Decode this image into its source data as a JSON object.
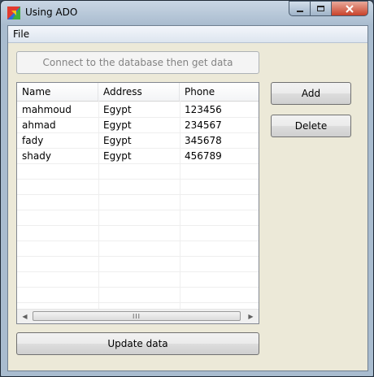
{
  "window": {
    "title": "Using ADO"
  },
  "menu": {
    "file": "File"
  },
  "buttons": {
    "connect": "Connect to the database then get data",
    "add": "Add",
    "delete": "Delete",
    "update": "Update data"
  },
  "table": {
    "columns": [
      "Name",
      "Address",
      "Phone"
    ],
    "rows": [
      [
        "mahmoud",
        "Egypt",
        "123456"
      ],
      [
        "ahmad",
        "Egypt",
        "234567"
      ],
      [
        "fady",
        "Egypt",
        "345678"
      ],
      [
        "shady",
        "Egypt",
        "456789"
      ]
    ]
  },
  "scrollbar": {
    "grip": "III"
  },
  "icons": {
    "app": "app-icon",
    "minimize": "minimize-icon",
    "maximize": "maximize-icon",
    "close": "close-icon",
    "scroll_left": "chevron-left-icon",
    "scroll_right": "chevron-right-icon"
  },
  "colors": {
    "close_button": "#c8422a",
    "client_background": "#ece9d8"
  }
}
